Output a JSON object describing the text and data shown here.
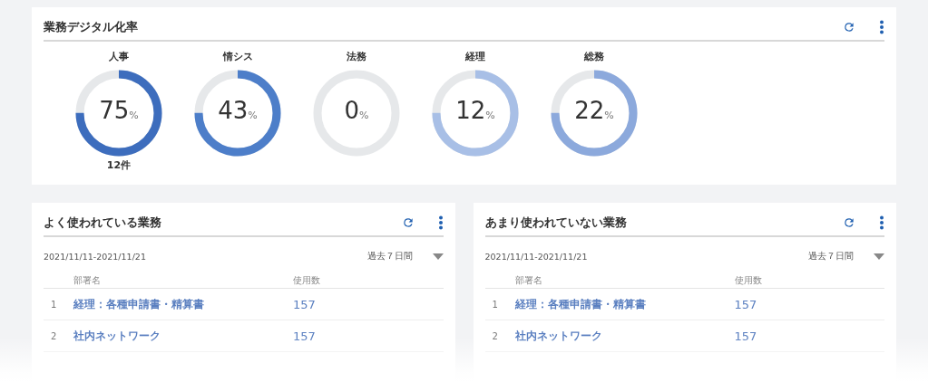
{
  "digitization": {
    "title": "業務デジタル化率",
    "departments": [
      {
        "name": "人事",
        "value": "75",
        "unit": "%",
        "color": "#3d6dbd",
        "count": "12件"
      },
      {
        "name": "情シス",
        "value": "43",
        "unit": "%",
        "color": "#4d7ec9"
      },
      {
        "name": "法務",
        "value": "0",
        "unit": "%"
      },
      {
        "name": "経理",
        "value": "12",
        "unit": "%",
        "color": "#a8bfe6"
      },
      {
        "name": "総務",
        "value": "22",
        "unit": "%",
        "color": "#8ca9dc"
      }
    ]
  },
  "panels": [
    {
      "title": "よく使われている業務",
      "date_range": "2021/11/11-2021/11/21",
      "period": "過去７日間",
      "columns": [
        "部署名",
        "使用数"
      ],
      "rows": [
        {
          "rank": "1",
          "name": "経理：各種申請書・精算書",
          "count": "157"
        },
        {
          "rank": "2",
          "name": "社内ネットワーク",
          "count": "157"
        }
      ]
    },
    {
      "title": "あまり使われていない業務",
      "date_range": "2021/11/11-2021/11/21",
      "period": "過去７日間",
      "columns": [
        "部署名",
        "使用数"
      ],
      "rows": [
        {
          "rank": "1",
          "name": "経理：各種申請書・精算書",
          "count": "157"
        },
        {
          "rank": "2",
          "name": "社内ネットワーク",
          "count": "157"
        }
      ]
    }
  ]
}
